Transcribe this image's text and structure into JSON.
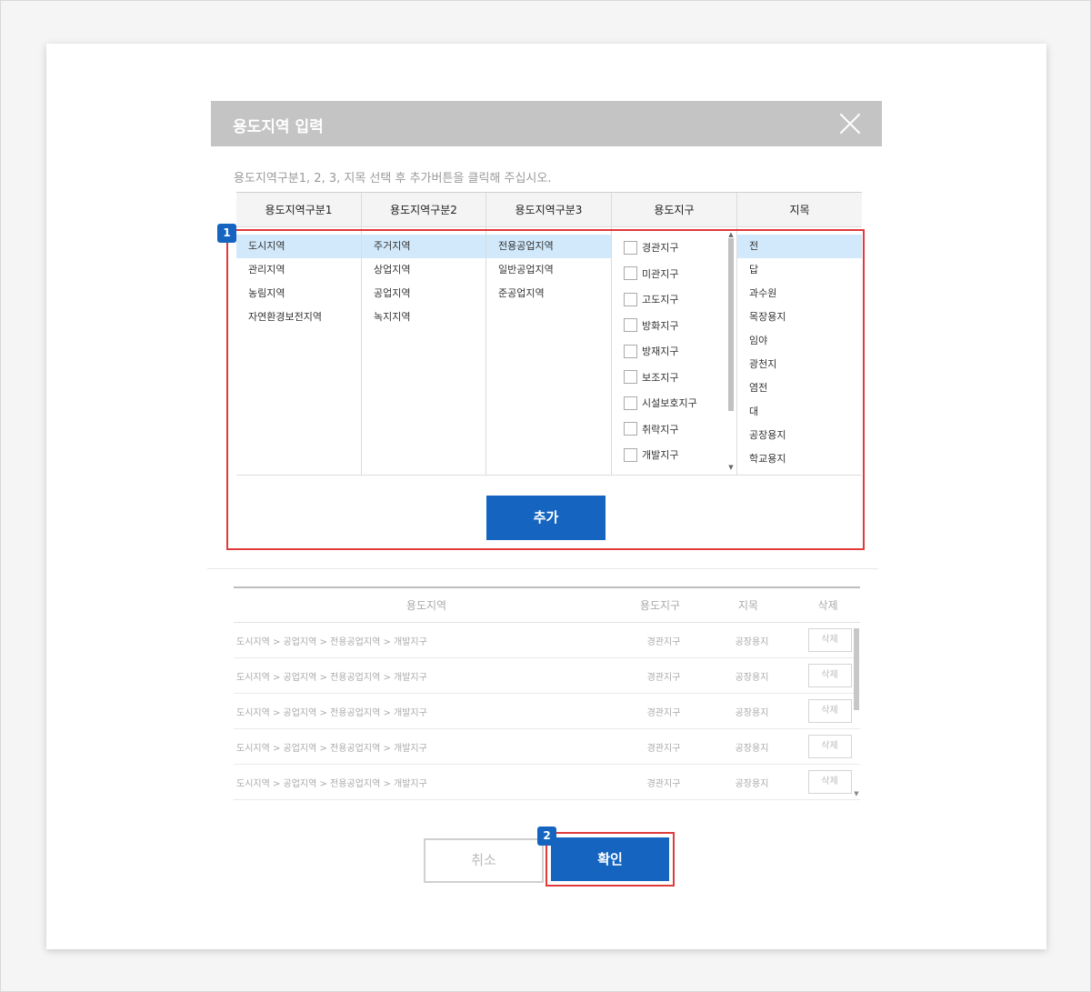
{
  "modal": {
    "title": "용도지역 입력",
    "instruction": "용도지역구분1, 2, 3, 지목 선택 후 추가버튼을 클릭해 주십시오."
  },
  "selector": {
    "headers": [
      "용도지역구분1",
      "용도지역구분2",
      "용도지역구분3",
      "용도지구",
      "지목"
    ],
    "col1": [
      "도시지역",
      "관리지역",
      "농림지역",
      "자연환경보전지역"
    ],
    "col2": [
      "주거지역",
      "상업지역",
      "공업지역",
      "녹지지역"
    ],
    "col3": [
      "전용공업지역",
      "일반공업지역",
      "준공업지역"
    ],
    "col4": [
      "경관지구",
      "미관지구",
      "고도지구",
      "방화지구",
      "방재지구",
      "보조지구",
      "시설보호지구",
      "취락지구",
      "개발지구"
    ],
    "col5": [
      "전",
      "답",
      "과수원",
      "목장용지",
      "임야",
      "광천지",
      "염전",
      "대",
      "공장용지",
      "학교용지"
    ],
    "selected": {
      "col1": 0,
      "col2": 0,
      "col3": 0,
      "col5": 0
    },
    "add_label": "추가"
  },
  "result": {
    "headers": [
      "용도지역",
      "용도지구",
      "지목",
      "삭제"
    ],
    "rows": [
      {
        "zone": "도시지역 > 공업지역 > 전용공업지역 > 개발지구",
        "district": "경관지구",
        "land": "공장용지",
        "delete": "삭제"
      },
      {
        "zone": "도시지역 > 공업지역 > 전용공업지역 > 개발지구",
        "district": "경관지구",
        "land": "공장용지",
        "delete": "삭제"
      },
      {
        "zone": "도시지역 > 공업지역 > 전용공업지역 > 개발지구",
        "district": "경관지구",
        "land": "공장용지",
        "delete": "삭제"
      },
      {
        "zone": "도시지역 > 공업지역 > 전용공업지역 > 개발지구",
        "district": "경관지구",
        "land": "공장용지",
        "delete": "삭제"
      },
      {
        "zone": "도시지역 > 공업지역 > 전용공업지역 > 개발지구",
        "district": "경관지구",
        "land": "공장용지",
        "delete": "삭제"
      }
    ]
  },
  "footer": {
    "cancel_label": "취소",
    "ok_label": "확인"
  },
  "badges": {
    "one": "1",
    "two": "2"
  },
  "colors": {
    "accent": "#1565c0",
    "highlight": "#e03a3a",
    "selected_row": "#d2e9fb",
    "header_bar": "#c4c4c4"
  },
  "icons": {
    "close": "close-icon",
    "checkbox": "checkbox-icon"
  }
}
